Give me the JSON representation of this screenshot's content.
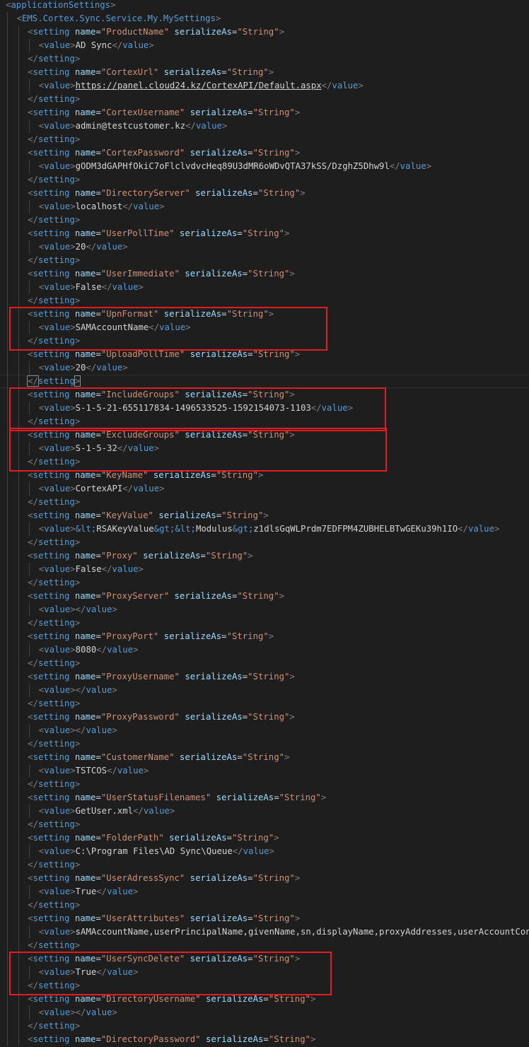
{
  "editor": {
    "root_tag": "applicationSettings",
    "section_tag": "EMS.Cortex.Sync.Service.My.MySettings",
    "setting_tag": "setting",
    "value_tag": "value",
    "name_attr": "name",
    "serialize_attr": "serializeAs",
    "serialize_value": "String",
    "settings": [
      {
        "name": "ProductName",
        "value": "AD Sync"
      },
      {
        "name": "CortexUrl",
        "value": "https://panel.cloud24.kz/CortexAPI/Default.aspx"
      },
      {
        "name": "CortexUsername",
        "value": "admin@testcustomer.kz"
      },
      {
        "name": "CortexPassword",
        "value": "gODM3dGAPHfOkiC7oFlclvdvcHeq89U3dMR6oWDvQTA37kSS/DzghZ5Dhw9l"
      },
      {
        "name": "DirectoryServer",
        "value": "localhost"
      },
      {
        "name": "UserPollTime",
        "value": "20"
      },
      {
        "name": "UserImmediate",
        "value": "False"
      },
      {
        "name": "UpnFormat",
        "value": "SAMAccountName"
      },
      {
        "name": "UploadPollTime",
        "value": "20"
      },
      {
        "name": "IncludeGroups",
        "value": "S-1-5-21-655117834-1496533525-1592154073-1103"
      },
      {
        "name": "ExcludeGroups",
        "value": "S-1-5-32"
      },
      {
        "name": "KeyName",
        "value": "CortexAPI"
      },
      {
        "name": "KeyValue",
        "value_parts": [
          "&lt;",
          "RSAKeyValue",
          "&gt;",
          "&lt;",
          "Modulus",
          "&gt;",
          "z1dlsGqWLPrdm7EDFPM4ZUBHELBTwGEKu39h1IO"
        ]
      },
      {
        "name": "Proxy",
        "value": "False"
      },
      {
        "name": "ProxyServer",
        "value": ""
      },
      {
        "name": "ProxyPort",
        "value": "8080"
      },
      {
        "name": "ProxyUsername",
        "value": ""
      },
      {
        "name": "ProxyPassword",
        "value": ""
      },
      {
        "name": "CustomerName",
        "value": "TSTCOS"
      },
      {
        "name": "UserStatusFilenames",
        "value": "GetUser.xml"
      },
      {
        "name": "FolderPath",
        "value": "C:\\Program Files\\AD Sync\\Queue"
      },
      {
        "name": "UserAdressSync",
        "value": "True"
      },
      {
        "name": "UserAttributes",
        "value": "sAMAccountName,userPrincipalName,givenName,sn,displayName,proxyAddresses,userAccountControl"
      },
      {
        "name": "UserSyncDelete",
        "value": "True"
      },
      {
        "name": "DirectoryUsername",
        "value": ""
      },
      {
        "name": "DirectoryPassword"
      }
    ]
  },
  "colors": {
    "background": "#1e1e1e",
    "tag": "#569cd6",
    "punctuation": "#808080",
    "attribute": "#9cdcfe",
    "string": "#ce9178",
    "text": "#d4d4d4",
    "highlight_box": "#e31b23"
  },
  "highlighted_settings": [
    "UpnFormat",
    "IncludeGroups",
    "ExcludeGroups",
    "UserSyncDelete"
  ]
}
